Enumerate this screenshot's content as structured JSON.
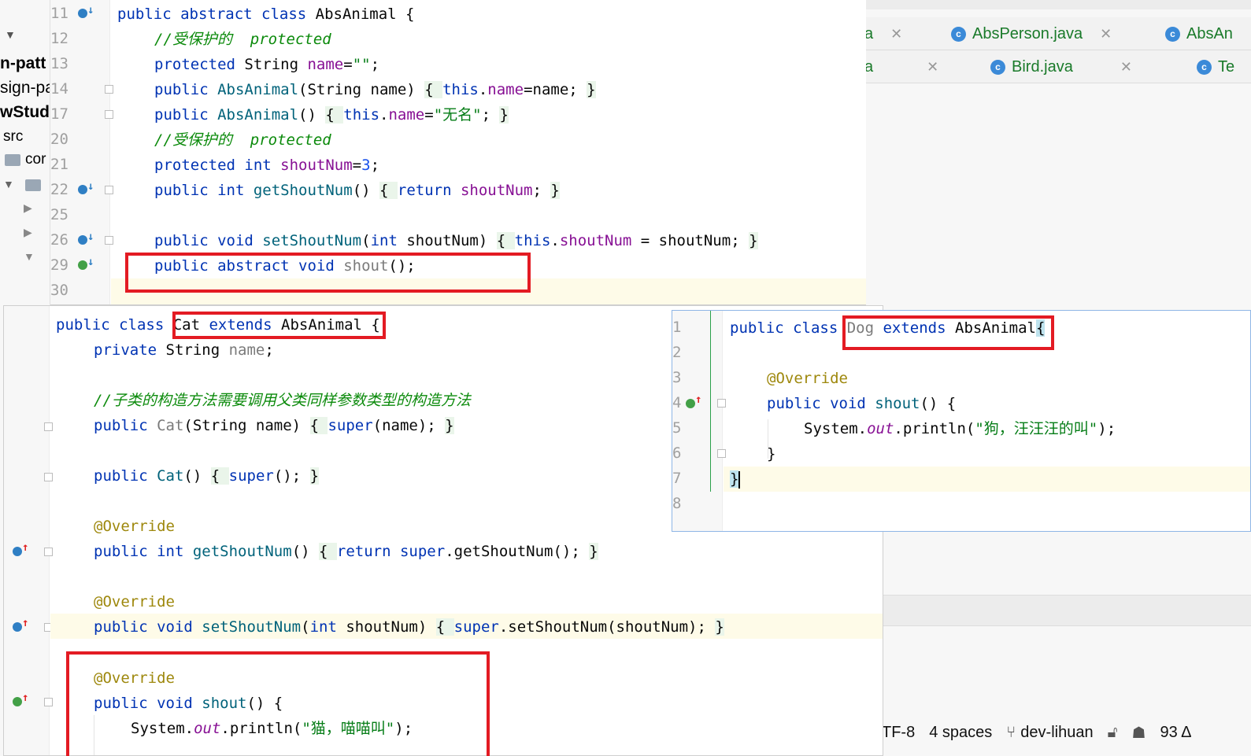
{
  "project_sidebar": {
    "items": [
      "n-patt",
      "sign-pa",
      "wStud",
      "src",
      "cor"
    ]
  },
  "editor_tabs": {
    "row1": [
      {
        "label": "a",
        "icon": "class-icon"
      },
      {
        "label": "AbsPerson.java",
        "icon": "class-icon"
      },
      {
        "label": "AbsAn",
        "icon": "class-icon"
      }
    ],
    "row2": [
      {
        "label": "a",
        "icon": "class-icon"
      },
      {
        "label": "Bird.java",
        "icon": "class-icon"
      },
      {
        "label": "Te",
        "icon": "class-icon"
      }
    ]
  },
  "status_bar": {
    "encoding": "TF-8",
    "indent": "4 spaces",
    "branch": "dev-lihuan",
    "count": "93 Δ"
  },
  "abs_animal": {
    "line_numbers": [
      "11",
      "12",
      "13",
      "14",
      "17",
      "20",
      "21",
      "22",
      "25",
      "26",
      "29",
      "30"
    ],
    "l11": {
      "a": "public abstract class ",
      "b": "AbsAnimal {"
    },
    "l12": "//受保护的  protected",
    "l13": {
      "a": "protected ",
      "b": "String ",
      "c": "name",
      "d": "=",
      "e": "\"\"",
      "f": ";"
    },
    "l14": {
      "a": "public ",
      "b": "AbsAnimal",
      "c": "(String name) ",
      "d": "{ ",
      "e": "this",
      "f": ".",
      "g": "name",
      "h": "=name; ",
      "i": "}"
    },
    "l17": {
      "a": "public ",
      "b": "AbsAnimal",
      "c": "() ",
      "d": "{ ",
      "e": "this",
      "f": ".",
      "g": "name",
      "h": "=",
      "i": "\"无名\"",
      "j": "; ",
      "k": "}"
    },
    "l20": "//受保护的  protected",
    "l21": {
      "a": "protected ",
      "b": "int ",
      "c": "shoutNum",
      "d": "=",
      "e": "3",
      "f": ";"
    },
    "l22": {
      "a": "public ",
      "b": "int ",
      "c": "getShoutNum",
      "d": "() ",
      "e": "{ ",
      "f": "return ",
      "g": "shoutNum",
      "h": "; ",
      "i": "}"
    },
    "l26": {
      "a": "public ",
      "b": "void ",
      "c": "setShoutNum",
      "d": "(",
      "e": "int ",
      "f": "shoutNum) ",
      "g": "{ ",
      "h": "this",
      "i": ".",
      "j": "shoutNum",
      "k": " = shoutNum; ",
      "l": "}"
    },
    "l29": {
      "a": "public abstract void ",
      "b": "shout",
      "c": "();"
    }
  },
  "cat": {
    "l1": {
      "a": "public class ",
      "b": "Cat ",
      "c": "extends ",
      "d": "AbsAnimal ",
      "e": "{"
    },
    "l2": {
      "a": "private ",
      "b": "String ",
      "c": "name",
      "d": ";"
    },
    "l4": "//子类的构造方法需要调用父类同样参数类型的构造方法",
    "l5": {
      "a": "public ",
      "b": "Cat",
      "c": "(String name) ",
      "d": "{ ",
      "e": "super",
      "f": "(name); ",
      "g": "}"
    },
    "l7": {
      "a": "public ",
      "b": "Cat",
      "c": "() ",
      "d": "{ ",
      "e": "super",
      "f": "(); ",
      "g": "}"
    },
    "l9": "@Override",
    "l10": {
      "a": "public ",
      "b": "int ",
      "c": "getShoutNum",
      "d": "() ",
      "e": "{ ",
      "f": "return ",
      "g": "super",
      "h": ".getShoutNum(); ",
      "i": "}"
    },
    "l12": "@Override",
    "l13": {
      "a": "public ",
      "b": "void ",
      "c": "setShoutNum",
      "d": "(",
      "e": "int ",
      "f": "shoutNum) ",
      "g": "{ ",
      "h": "super",
      "i": ".setShoutNum(shoutNum); ",
      "j": "}"
    },
    "l15": "@Override",
    "l16": {
      "a": "public ",
      "b": "void ",
      "c": "shout",
      "d": "() {"
    },
    "l17": {
      "a": "System.",
      "b": "out",
      "c": ".println(",
      "d": "\"猫，喵喵叫\"",
      "e": ");"
    }
  },
  "dog": {
    "line_numbers": [
      "1",
      "2",
      "3",
      "4",
      "5",
      "6",
      "7",
      "8"
    ],
    "l1": {
      "a": "public class ",
      "b": "Dog ",
      "c": "extends ",
      "d": "AbsAnimal",
      "e": "{"
    },
    "l3": "@Override",
    "l4": {
      "a": "public ",
      "b": "void ",
      "c": "shout",
      "d": "() {"
    },
    "l5": {
      "a": "System.",
      "b": "out",
      "c": ".println(",
      "d": "\"狗，汪汪汪的叫\"",
      "e": ");"
    },
    "l6": "}",
    "l7": "}"
  },
  "colors": {
    "highlight_box": "#e31b23",
    "keyword": "#0033b3",
    "comment": "#0b8a0b",
    "field": "#871094",
    "string": "#067d17",
    "annotation": "#9e880d"
  }
}
